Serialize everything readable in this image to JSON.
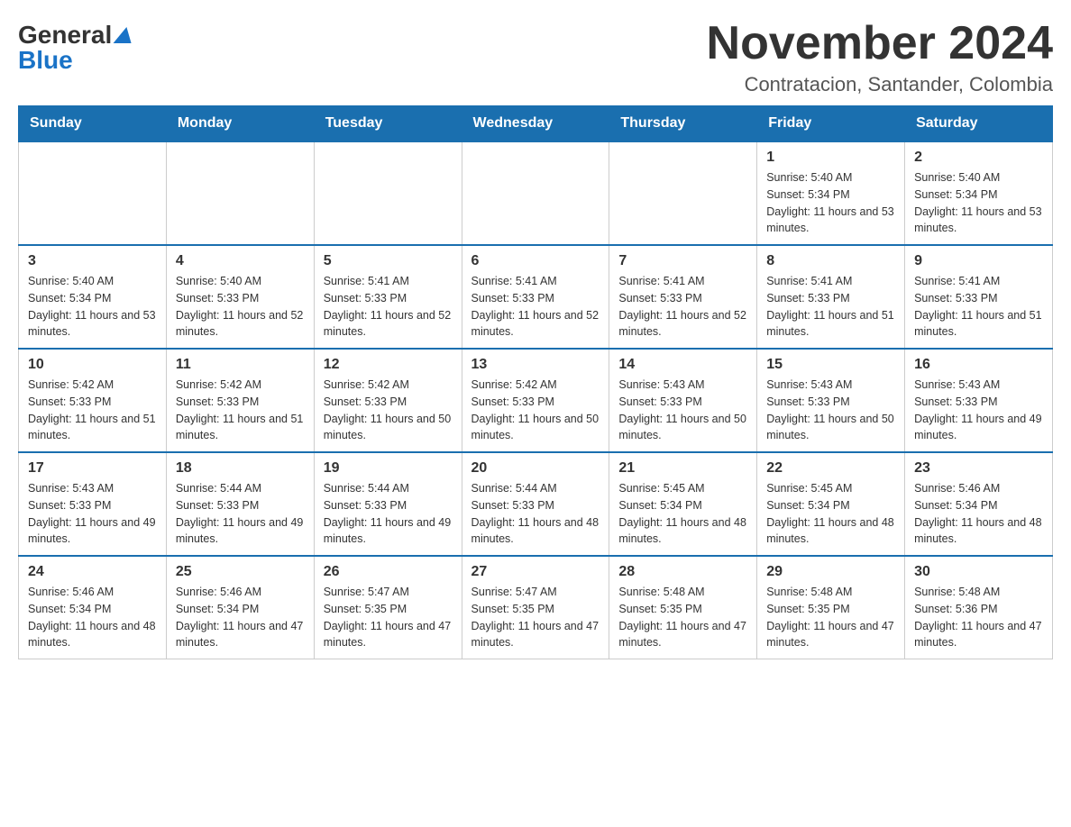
{
  "logo": {
    "general": "General",
    "blue": "Blue"
  },
  "title": "November 2024",
  "subtitle": "Contratacion, Santander, Colombia",
  "weekdays": [
    "Sunday",
    "Monday",
    "Tuesday",
    "Wednesday",
    "Thursday",
    "Friday",
    "Saturday"
  ],
  "weeks": [
    [
      {
        "day": "",
        "info": ""
      },
      {
        "day": "",
        "info": ""
      },
      {
        "day": "",
        "info": ""
      },
      {
        "day": "",
        "info": ""
      },
      {
        "day": "",
        "info": ""
      },
      {
        "day": "1",
        "info": "Sunrise: 5:40 AM\nSunset: 5:34 PM\nDaylight: 11 hours and 53 minutes."
      },
      {
        "day": "2",
        "info": "Sunrise: 5:40 AM\nSunset: 5:34 PM\nDaylight: 11 hours and 53 minutes."
      }
    ],
    [
      {
        "day": "3",
        "info": "Sunrise: 5:40 AM\nSunset: 5:34 PM\nDaylight: 11 hours and 53 minutes."
      },
      {
        "day": "4",
        "info": "Sunrise: 5:40 AM\nSunset: 5:33 PM\nDaylight: 11 hours and 52 minutes."
      },
      {
        "day": "5",
        "info": "Sunrise: 5:41 AM\nSunset: 5:33 PM\nDaylight: 11 hours and 52 minutes."
      },
      {
        "day": "6",
        "info": "Sunrise: 5:41 AM\nSunset: 5:33 PM\nDaylight: 11 hours and 52 minutes."
      },
      {
        "day": "7",
        "info": "Sunrise: 5:41 AM\nSunset: 5:33 PM\nDaylight: 11 hours and 52 minutes."
      },
      {
        "day": "8",
        "info": "Sunrise: 5:41 AM\nSunset: 5:33 PM\nDaylight: 11 hours and 51 minutes."
      },
      {
        "day": "9",
        "info": "Sunrise: 5:41 AM\nSunset: 5:33 PM\nDaylight: 11 hours and 51 minutes."
      }
    ],
    [
      {
        "day": "10",
        "info": "Sunrise: 5:42 AM\nSunset: 5:33 PM\nDaylight: 11 hours and 51 minutes."
      },
      {
        "day": "11",
        "info": "Sunrise: 5:42 AM\nSunset: 5:33 PM\nDaylight: 11 hours and 51 minutes."
      },
      {
        "day": "12",
        "info": "Sunrise: 5:42 AM\nSunset: 5:33 PM\nDaylight: 11 hours and 50 minutes."
      },
      {
        "day": "13",
        "info": "Sunrise: 5:42 AM\nSunset: 5:33 PM\nDaylight: 11 hours and 50 minutes."
      },
      {
        "day": "14",
        "info": "Sunrise: 5:43 AM\nSunset: 5:33 PM\nDaylight: 11 hours and 50 minutes."
      },
      {
        "day": "15",
        "info": "Sunrise: 5:43 AM\nSunset: 5:33 PM\nDaylight: 11 hours and 50 minutes."
      },
      {
        "day": "16",
        "info": "Sunrise: 5:43 AM\nSunset: 5:33 PM\nDaylight: 11 hours and 49 minutes."
      }
    ],
    [
      {
        "day": "17",
        "info": "Sunrise: 5:43 AM\nSunset: 5:33 PM\nDaylight: 11 hours and 49 minutes."
      },
      {
        "day": "18",
        "info": "Sunrise: 5:44 AM\nSunset: 5:33 PM\nDaylight: 11 hours and 49 minutes."
      },
      {
        "day": "19",
        "info": "Sunrise: 5:44 AM\nSunset: 5:33 PM\nDaylight: 11 hours and 49 minutes."
      },
      {
        "day": "20",
        "info": "Sunrise: 5:44 AM\nSunset: 5:33 PM\nDaylight: 11 hours and 48 minutes."
      },
      {
        "day": "21",
        "info": "Sunrise: 5:45 AM\nSunset: 5:34 PM\nDaylight: 11 hours and 48 minutes."
      },
      {
        "day": "22",
        "info": "Sunrise: 5:45 AM\nSunset: 5:34 PM\nDaylight: 11 hours and 48 minutes."
      },
      {
        "day": "23",
        "info": "Sunrise: 5:46 AM\nSunset: 5:34 PM\nDaylight: 11 hours and 48 minutes."
      }
    ],
    [
      {
        "day": "24",
        "info": "Sunrise: 5:46 AM\nSunset: 5:34 PM\nDaylight: 11 hours and 48 minutes."
      },
      {
        "day": "25",
        "info": "Sunrise: 5:46 AM\nSunset: 5:34 PM\nDaylight: 11 hours and 47 minutes."
      },
      {
        "day": "26",
        "info": "Sunrise: 5:47 AM\nSunset: 5:35 PM\nDaylight: 11 hours and 47 minutes."
      },
      {
        "day": "27",
        "info": "Sunrise: 5:47 AM\nSunset: 5:35 PM\nDaylight: 11 hours and 47 minutes."
      },
      {
        "day": "28",
        "info": "Sunrise: 5:48 AM\nSunset: 5:35 PM\nDaylight: 11 hours and 47 minutes."
      },
      {
        "day": "29",
        "info": "Sunrise: 5:48 AM\nSunset: 5:35 PM\nDaylight: 11 hours and 47 minutes."
      },
      {
        "day": "30",
        "info": "Sunrise: 5:48 AM\nSunset: 5:36 PM\nDaylight: 11 hours and 47 minutes."
      }
    ]
  ]
}
